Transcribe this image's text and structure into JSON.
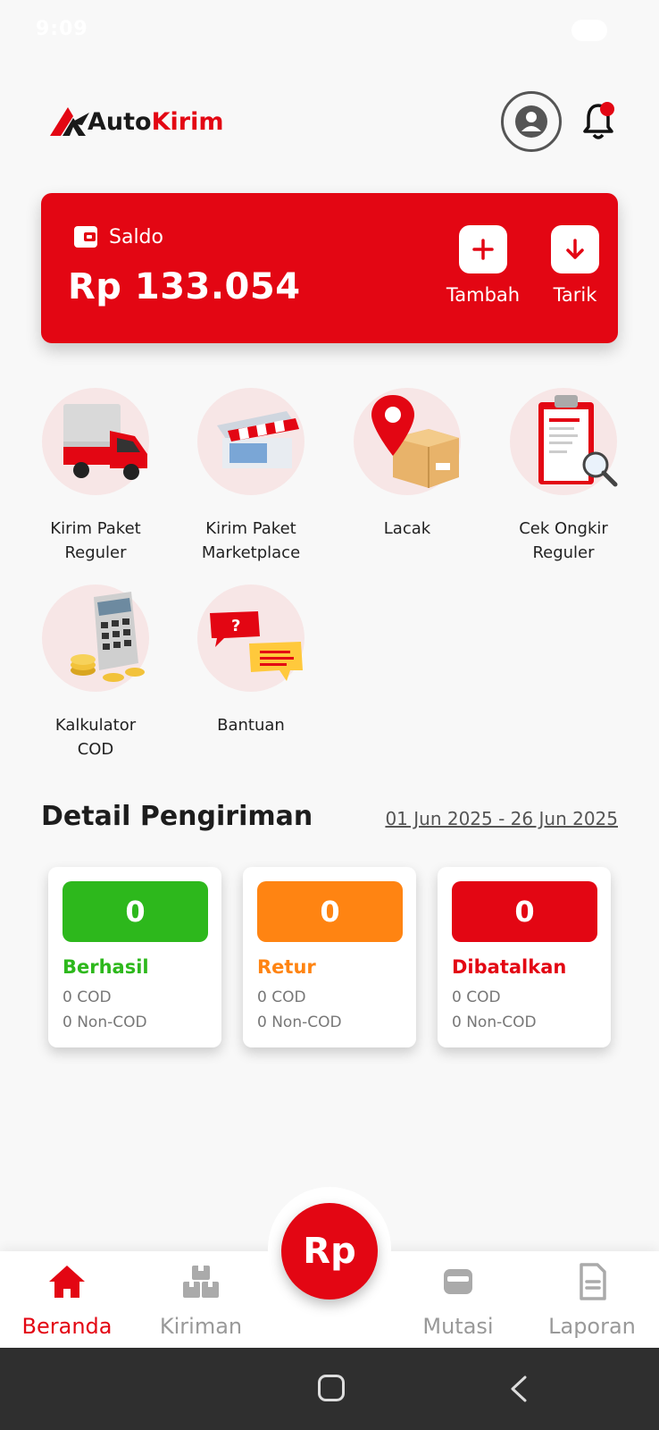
{
  "status_bar": {
    "time": "9:09"
  },
  "app": {
    "logo_auto": "Auto",
    "logo_kirim": "Kirim",
    "brand_color": "#e30613"
  },
  "saldo": {
    "label": "Saldo",
    "amount": "Rp 133.054",
    "tambah_label": "Tambah",
    "tarik_label": "Tarik"
  },
  "menu": [
    {
      "line1": "Kirim Paket",
      "line2": "Reguler",
      "icon": "truck-icon"
    },
    {
      "line1": "Kirim Paket",
      "line2": "Marketplace",
      "icon": "store-icon"
    },
    {
      "line1": "Lacak",
      "line2": "",
      "icon": "location-package-icon"
    },
    {
      "line1": "Cek Ongkir",
      "line2": "Reguler",
      "icon": "clipboard-search-icon"
    },
    {
      "line1": "Kalkulator",
      "line2": "COD",
      "icon": "calculator-coins-icon"
    },
    {
      "line1": "Bantuan",
      "line2": "",
      "icon": "chat-help-icon"
    }
  ],
  "detail": {
    "title": "Detail Pengiriman",
    "date_range": "01 Jun 2025 - 26 Jun 2025",
    "cards": [
      {
        "count": "0",
        "name": "Berhasil",
        "cod": "0 COD",
        "non_cod": "0 Non-COD",
        "color": "#2db81c"
      },
      {
        "count": "0",
        "name": "Retur",
        "cod": "0 COD",
        "non_cod": "0 Non-COD",
        "color": "#ff8412"
      },
      {
        "count": "0",
        "name": "Dibatalkan",
        "cod": "0 COD",
        "non_cod": "0 Non-COD",
        "color": "#e30613"
      }
    ]
  },
  "bottom_nav": {
    "beranda": "Beranda",
    "kiriman": "Kiriman",
    "fab": "Rp",
    "mutasi": "Mutasi",
    "laporan": "Laporan"
  }
}
